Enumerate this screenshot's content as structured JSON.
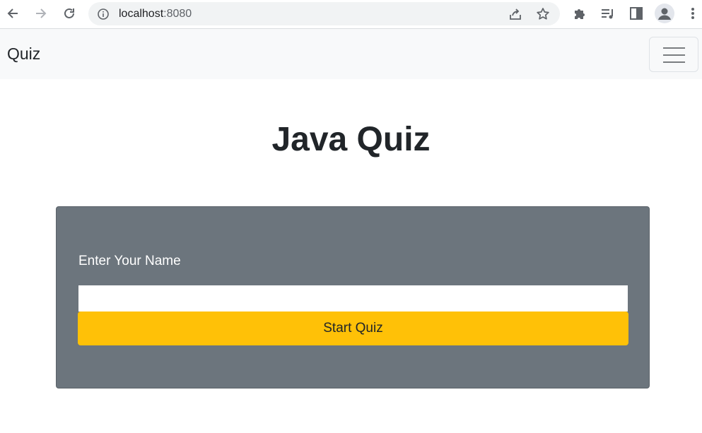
{
  "browser": {
    "url_host": "localhost",
    "url_port": ":8080"
  },
  "navbar": {
    "brand": "Quiz"
  },
  "main": {
    "title": "Java Quiz",
    "name_label": "Enter Your Name",
    "name_value": "",
    "start_button": "Start Quiz"
  },
  "icons": {
    "back": "back-arrow-icon",
    "forward": "forward-arrow-icon",
    "reload": "reload-icon",
    "info": "info-icon",
    "share": "share-icon",
    "bookmark": "star-icon",
    "extensions": "puzzle-icon",
    "reading_list": "reading-list-icon",
    "side_panel": "side-panel-icon",
    "profile": "profile-avatar-icon",
    "menu": "kebab-menu-icon",
    "hamburger": "hamburger-icon"
  },
  "colors": {
    "card_bg": "#6c757d",
    "button_bg": "#ffc107",
    "navbar_bg": "#f8f9fa"
  }
}
